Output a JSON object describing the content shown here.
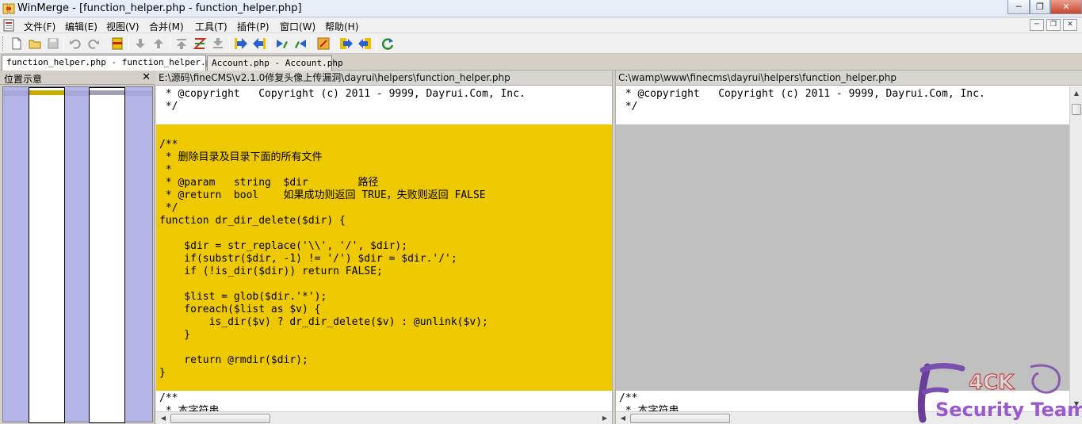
{
  "window": {
    "title": "WinMerge - [function_helper.php - function_helper.php]",
    "minimize_label": "─",
    "maximize_label": "❐",
    "close_label": "✕"
  },
  "menu": {
    "items": [
      "文件(F)",
      "编辑(E)",
      "视图(V)",
      "合并(M)",
      "工具(T)",
      "插件(P)",
      "窗口(W)",
      "帮助(H)"
    ],
    "mdi_minimize": "─",
    "mdi_restore": "❐",
    "mdi_close": "✕"
  },
  "tabs": [
    {
      "label": "function_helper.php - function_helper.php",
      "active": true
    },
    {
      "label": "Account.php - Account.php",
      "active": false
    }
  ],
  "location_pane": {
    "title": "位置示意",
    "close_label": "✕"
  },
  "left_pane": {
    "path": "E:\\源码\\fineCMS\\v2.1.0修复头像上传漏洞\\dayrui\\helpers\\function_helper.php",
    "lines": [
      " * @copyright   Copyright (c) 2011 - 9999, Dayrui.Com, Inc.",
      " */",
      "",
      "",
      "/**",
      " * 删除目录及目录下面的所有文件",
      " *",
      " * @param   string  $dir        路径",
      " * @return  bool    如果成功则返回 TRUE，失败则返回 FALSE",
      " */",
      "function dr_dir_delete($dir) {",
      "",
      "    $dir = str_replace('\\\\', '/', $dir);",
      "    if(substr($dir, -1) != '/') $dir = $dir.'/';",
      "    if (!is_dir($dir)) return FALSE;",
      "",
      "    $list = glob($dir.'*');",
      "    foreach($list as $v) {",
      "        is_dir($v) ? dr_dir_delete($v) : @unlink($v);",
      "    }",
      "",
      "    return @rmdir($dir);",
      "}",
      "",
      "/**",
      " * 本字符串..."
    ]
  },
  "right_pane": {
    "path": "C:\\wamp\\www\\finecms\\dayrui\\helpers\\function_helper.php",
    "lines": [
      " * @copyright   Copyright (c) 2011 - 9999, Dayrui.Com, Inc.",
      " */",
      "/**",
      " * 本字符串..."
    ]
  },
  "colors": {
    "diff_changed": "#efc900",
    "diff_missing": "#c0c0c0",
    "location_bg": "#b4b4e6",
    "location_mark_left": "#c8aa00",
    "location_mark_right": "#a0a0b0"
  },
  "watermark": {
    "logo_letters": "4CK",
    "text": "Security Team"
  }
}
